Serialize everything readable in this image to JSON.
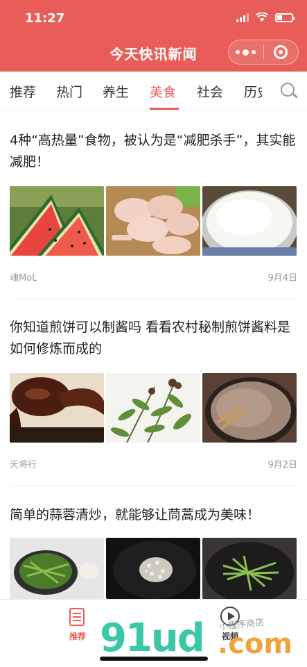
{
  "status_bar": {
    "time": "11:27"
  },
  "app": {
    "title": "今天快讯新闻"
  },
  "tabs": [
    "推荐",
    "热门",
    "养生",
    "美食",
    "社会",
    "历史"
  ],
  "active_tab": "美食",
  "articles": [
    {
      "title": "4种“高热量”食物，被认为是“减肥杀手”，其实能减肥！",
      "source": "魂MoL",
      "date": "9月4日",
      "images": [
        "watermelon slices",
        "raw chicken legs",
        "bowl of rice"
      ]
    },
    {
      "title": "你知道煎饼可以制酱吗 看看农村秘制煎饼酱料是如何修炼而成的",
      "source": "天将行",
      "date": "9月2日",
      "images": [
        "sauce on spoon",
        "peppercorn branch",
        "sauce in wok"
      ]
    },
    {
      "title": "简单的蒜蓉清炒，就能够让茼蒿成为美味！",
      "images": [
        "greens in pot",
        "minced garlic in wok",
        "stir-fried greens"
      ]
    }
  ],
  "bottom_tabs": [
    {
      "label": "推荐",
      "icon": "document-icon",
      "active": true
    },
    {
      "label": "视频",
      "icon": "play-icon",
      "active": false
    }
  ],
  "watermark": {
    "main": "91ud",
    "suffix": ".com",
    "sub": "小程序商店"
  },
  "colors": {
    "brand": "#e85d57",
    "text": "#222222",
    "meta": "#999999"
  }
}
